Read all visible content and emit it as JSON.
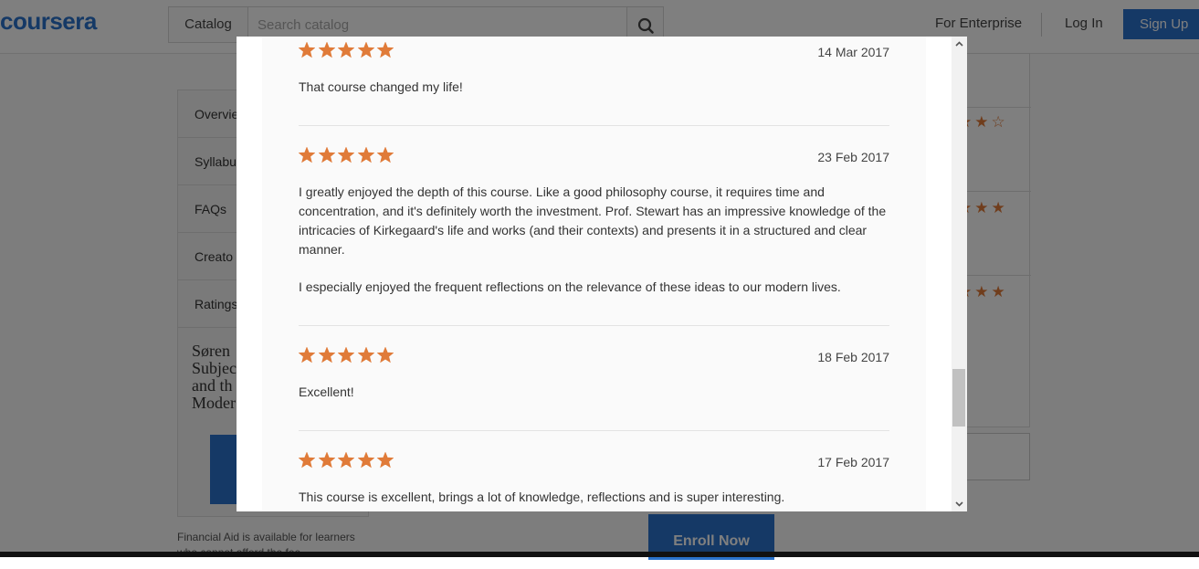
{
  "header": {
    "logo": "coursera",
    "catalog_label": "Catalog",
    "search_placeholder": "Search catalog",
    "for_enterprise": "For Enterprise",
    "log_in": "Log In",
    "sign_up": "Sign Up"
  },
  "sidebar": {
    "items": [
      {
        "label": "Overvie"
      },
      {
        "label": "Syllabu"
      },
      {
        "label": "FAQs"
      },
      {
        "label": "Creato"
      },
      {
        "label": "Ratings"
      }
    ],
    "course_title": "Søren\nSubjec\nand th\nModer",
    "financial_aid": "Financial Aid is available for learners who cannot afford the fee."
  },
  "main": {
    "enroll_label": "Enroll Now"
  },
  "modal": {
    "reviews": [
      {
        "stars": 5,
        "date": "14 Mar 2017",
        "text": [
          "That course changed my life!"
        ]
      },
      {
        "stars": 5,
        "date": "23 Feb 2017",
        "text": [
          "I greatly enjoyed the depth of this course. Like a good philosophy course, it requires time and concentration, and it's definitely worth the investment. Prof. Stewart has an impressive knowledge of the intricacies of Kirkegaard's life and works (and their contexts) and presents it in a structured and clear manner.",
          "I especially enjoyed the frequent reflections on the relevance of these ideas to our modern lives."
        ]
      },
      {
        "stars": 5,
        "date": "18 Feb 2017",
        "text": [
          "Excellent!"
        ]
      },
      {
        "stars": 5,
        "date": "17 Feb 2017",
        "text": [
          "This course is excellent, brings a lot of knowledge, reflections and is super interesting."
        ]
      }
    ]
  },
  "colors": {
    "brand": "#2a73cc",
    "star": "#e07b39",
    "overlay": "rgba(0,0,0,0.5)"
  },
  "icons": {
    "search": "search-icon",
    "star": "star-icon",
    "scroll_up": "chevron-up-icon",
    "scroll_down": "chevron-down-icon"
  }
}
